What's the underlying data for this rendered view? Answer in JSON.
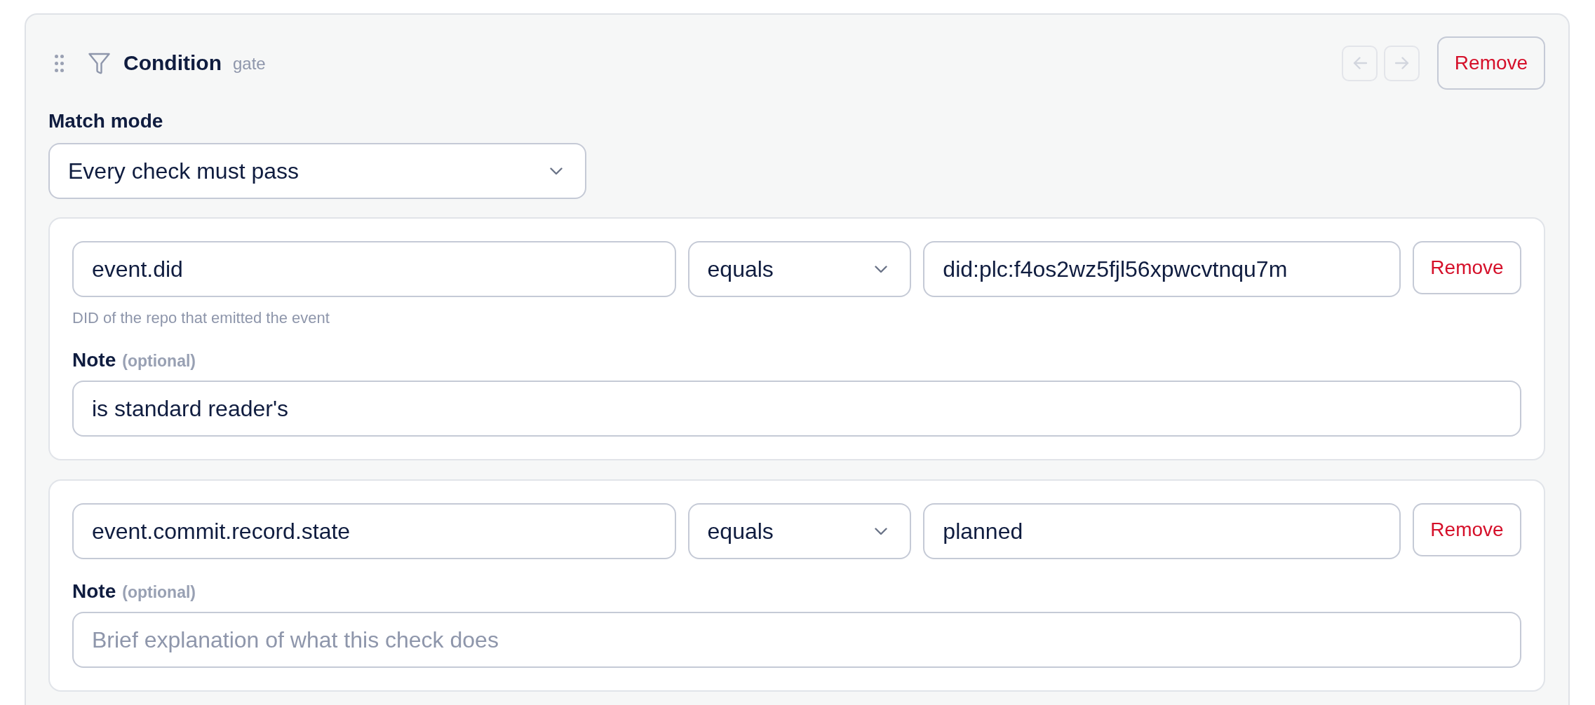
{
  "block": {
    "title": "Condition",
    "tag": "gate",
    "nav": [
      {
        "kind": "left",
        "disabled": true
      },
      {
        "kind": "right",
        "disabled": true
      }
    ],
    "remove_label": "Remove"
  },
  "match_mode": {
    "label": "Match mode",
    "value": "Every check must pass"
  },
  "checks": [
    {
      "field": "event.did",
      "operator": "equals",
      "value": "did:plc:f4os2wz5fjl56xpwcvtnqu7m",
      "remove_label": "Remove",
      "hint": "DID of the repo that emitted the event",
      "note_label": "Note",
      "note_optional": "(optional)",
      "note": {
        "value": "is standard reader's"
      }
    },
    {
      "field": "event.commit.record.state",
      "operator": "equals",
      "value": "planned",
      "remove_label": "Remove",
      "note_label": "Note",
      "note_optional": "(optional)",
      "note": {
        "placeholder": "Brief explanation of what this check does"
      }
    }
  ]
}
